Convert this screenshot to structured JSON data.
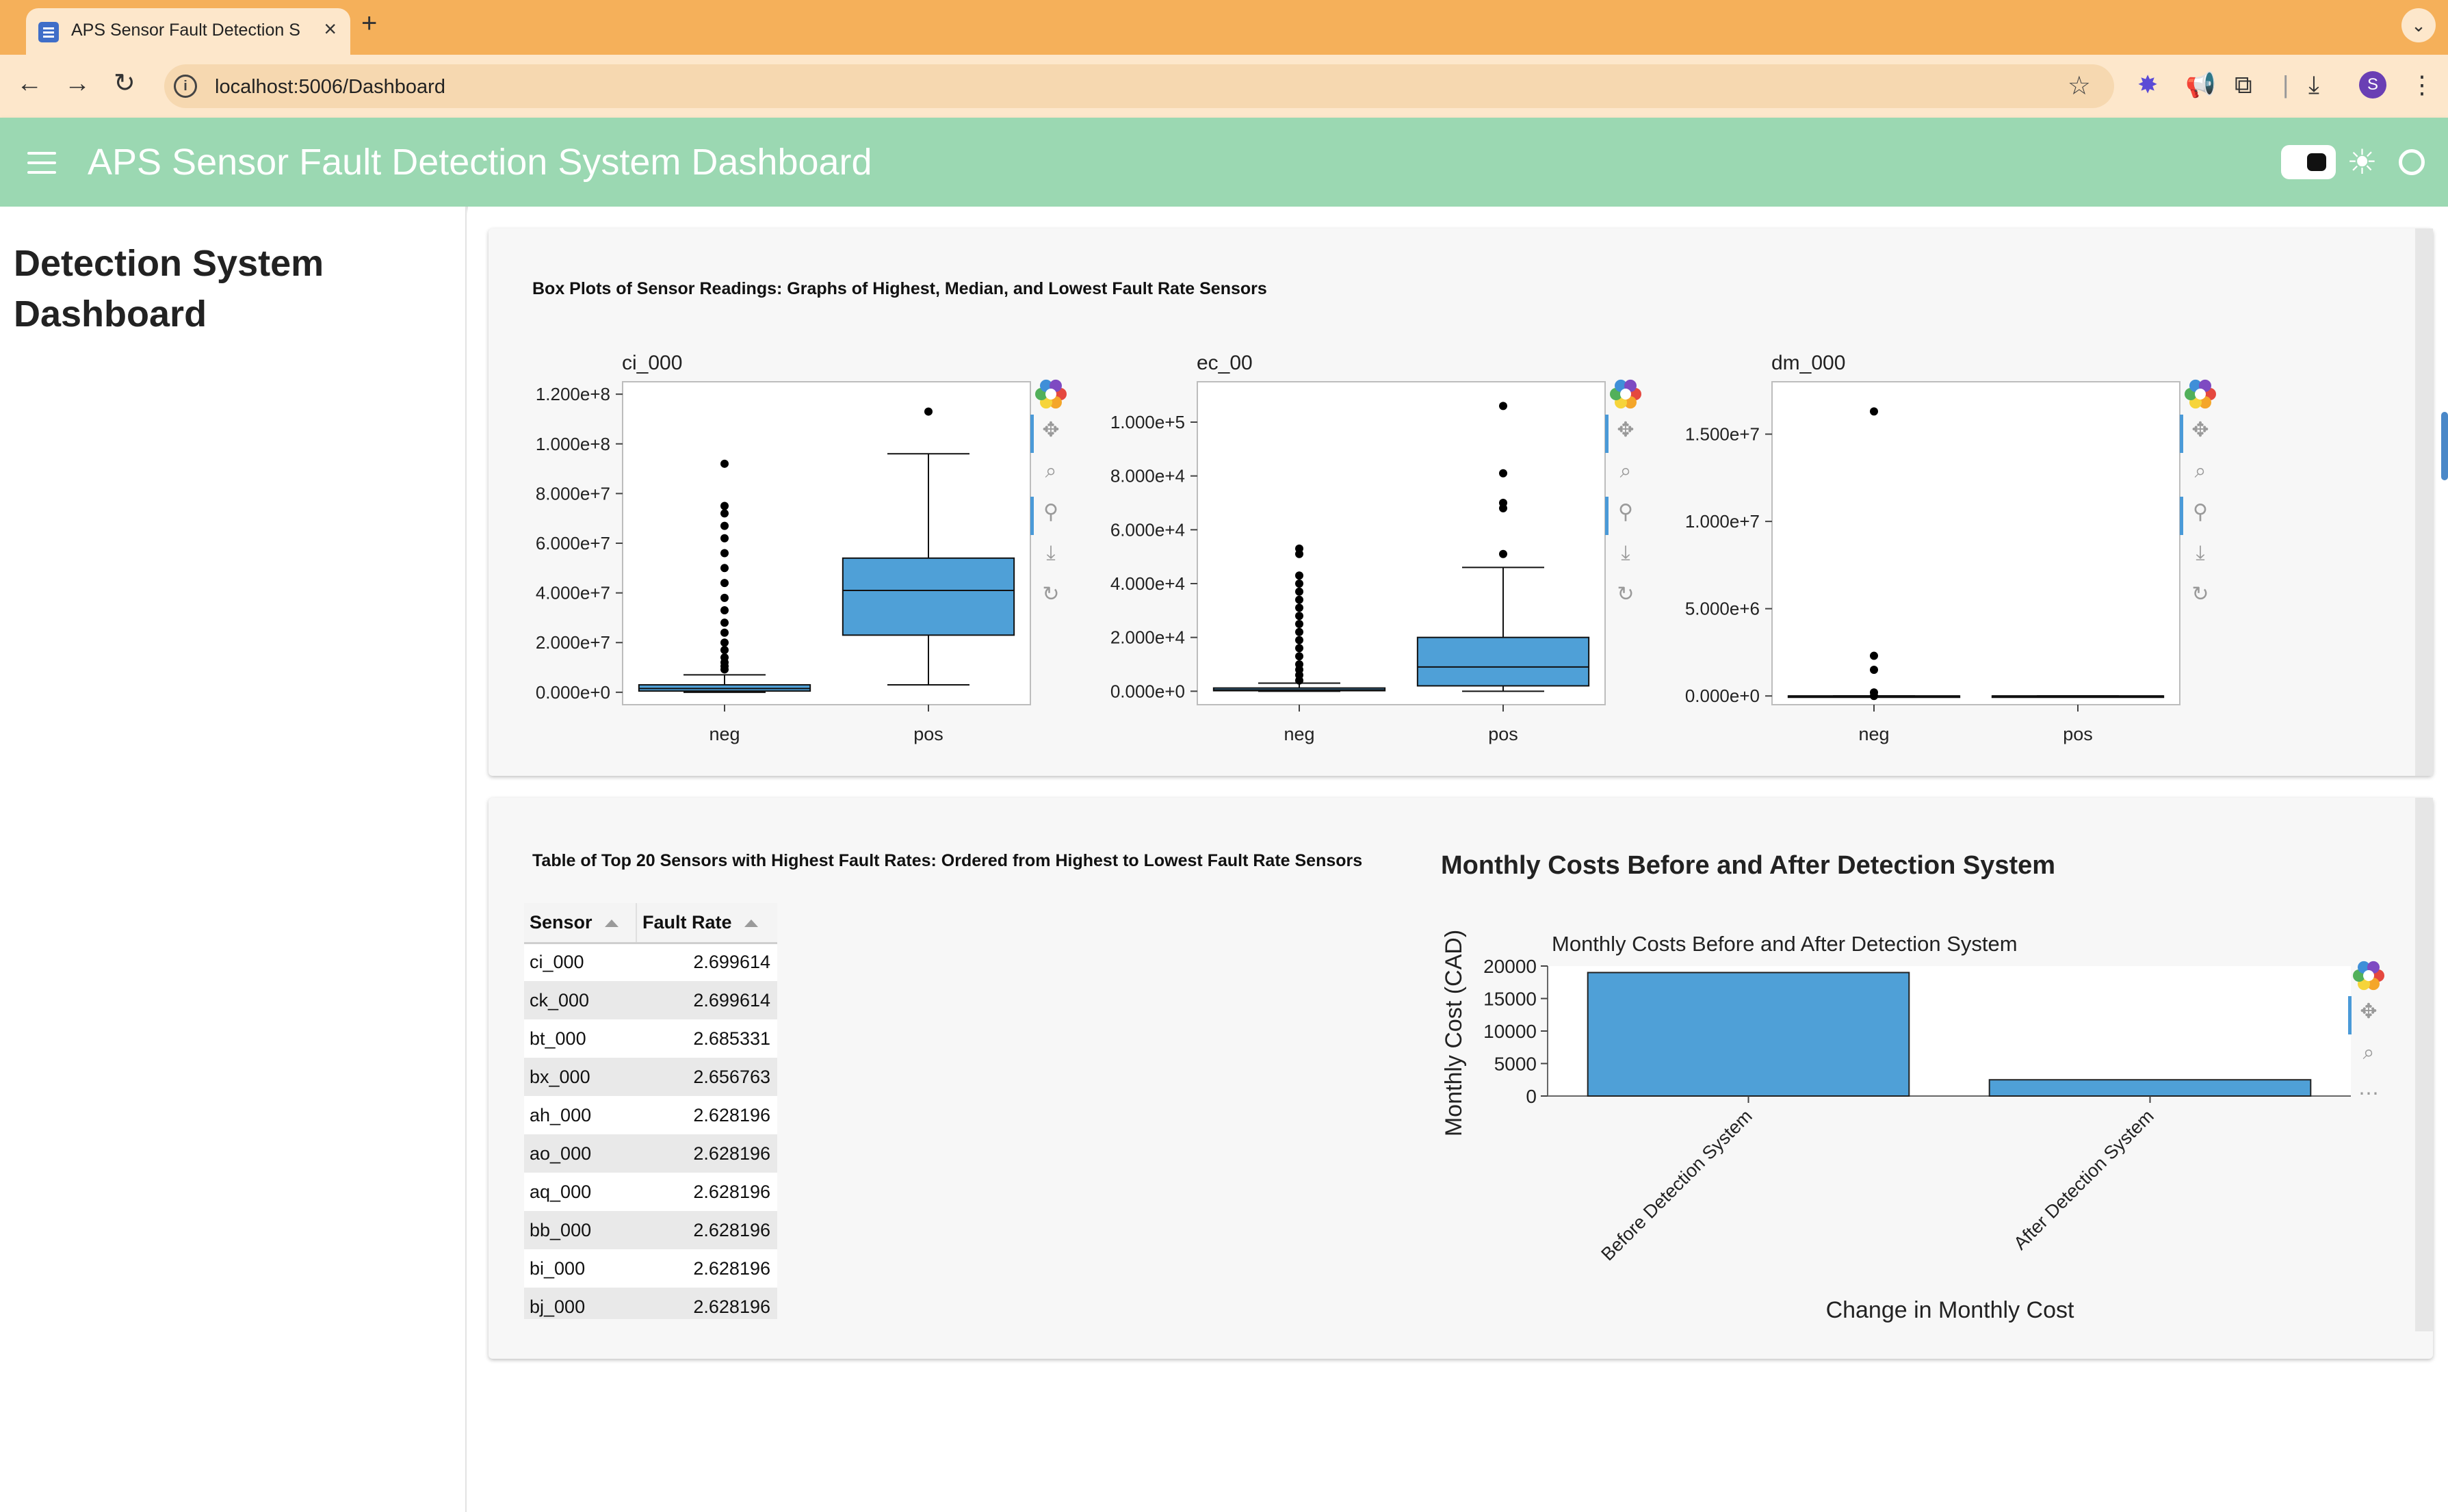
{
  "browser": {
    "tab_title": "APS Sensor Fault Detection S",
    "url": "localhost:5006/Dashboard",
    "profile_initial": "S"
  },
  "app": {
    "title": "APS Sensor Fault Detection System Dashboard"
  },
  "sidebar": {
    "title": "Detection System Dashboard"
  },
  "boxplots_section": {
    "heading": "Box Plots of Sensor Readings: Graphs of Highest, Median, and Lowest Fault Rate Sensors"
  },
  "table_section": {
    "heading": "Table of Top 20 Sensors with Highest Fault Rates: Ordered from Highest to Lowest Fault Rate Sensors",
    "columns": [
      "Sensor",
      "Fault Rate"
    ],
    "rows": [
      {
        "sensor": "ci_000",
        "rate": "2.699614"
      },
      {
        "sensor": "ck_000",
        "rate": "2.699614"
      },
      {
        "sensor": "bt_000",
        "rate": "2.685331"
      },
      {
        "sensor": "bx_000",
        "rate": "2.656763"
      },
      {
        "sensor": "ah_000",
        "rate": "2.628196"
      },
      {
        "sensor": "ao_000",
        "rate": "2.628196"
      },
      {
        "sensor": "aq_000",
        "rate": "2.628196"
      },
      {
        "sensor": "bb_000",
        "rate": "2.628196"
      },
      {
        "sensor": "bi_000",
        "rate": "2.628196"
      },
      {
        "sensor": "bj_000",
        "rate": "2.628196"
      }
    ]
  },
  "cost_section": {
    "heading": "Monthly Costs Before and After Detection System"
  },
  "colors": {
    "header_bg": "#9bd8b2",
    "tabbar_bg": "#f5b05a",
    "bar_fill": "#4fa0d7"
  },
  "chart_data": [
    {
      "type": "box",
      "title": "ci_000",
      "categories": [
        "neg",
        "pos"
      ],
      "ylim": [
        -5000000,
        125000000
      ],
      "yticks": [
        0,
        20000000,
        40000000,
        60000000,
        80000000,
        100000000,
        120000000
      ],
      "ytick_labels": [
        "0.000e+0",
        "2.000e+7",
        "4.000e+7",
        "6.000e+7",
        "8.000e+7",
        "1.000e+8",
        "1.200e+8"
      ],
      "boxes": [
        {
          "category": "neg",
          "whisker_low": 0,
          "q1": 500000,
          "median": 1500000,
          "q3": 3000000,
          "whisker_high": 7000000,
          "outliers": [
            9200000,
            10500000,
            12000000,
            14000000,
            17000000,
            20000000,
            24000000,
            28000000,
            33000000,
            38000000,
            44000000,
            50000000,
            56000000,
            62000000,
            67000000,
            72000000,
            75000000,
            92000000
          ]
        },
        {
          "category": "pos",
          "whisker_low": 3000000,
          "q1": 23000000,
          "median": 41000000,
          "q3": 54000000,
          "whisker_high": 96000000,
          "outliers": [
            113000000
          ]
        }
      ]
    },
    {
      "type": "box",
      "title": "ec_00",
      "categories": [
        "neg",
        "pos"
      ],
      "ylim": [
        -5000,
        115000
      ],
      "yticks": [
        0,
        20000,
        40000,
        60000,
        80000,
        100000
      ],
      "ytick_labels": [
        "0.000e+0",
        "2.000e+4",
        "4.000e+4",
        "6.000e+4",
        "8.000e+4",
        "1.000e+5"
      ],
      "boxes": [
        {
          "category": "neg",
          "whisker_low": 0,
          "q1": 200,
          "median": 500,
          "q3": 1200,
          "whisker_high": 3000,
          "outliers": [
            4000,
            6000,
            8000,
            10000,
            13000,
            16000,
            19000,
            22000,
            25000,
            28000,
            31000,
            34000,
            37000,
            40000,
            43000,
            51000,
            53000
          ]
        },
        {
          "category": "pos",
          "whisker_low": 0,
          "q1": 2000,
          "median": 9000,
          "q3": 20000,
          "whisker_high": 46000,
          "outliers": [
            51000,
            68000,
            70000,
            81000,
            106000
          ]
        }
      ]
    },
    {
      "type": "box",
      "title": "dm_000",
      "categories": [
        "neg",
        "pos"
      ],
      "ylim": [
        -500000,
        18000000
      ],
      "yticks": [
        0,
        5000000,
        10000000,
        15000000
      ],
      "ytick_labels": [
        "0.000e+0",
        "5.000e+6",
        "1.000e+7",
        "1.500e+7"
      ],
      "boxes": [
        {
          "category": "neg",
          "whisker_low": 0,
          "q1": 0,
          "median": 0,
          "q3": 0,
          "whisker_high": 0,
          "outliers": [
            0,
            200000,
            1500000,
            2300000,
            16300000
          ]
        },
        {
          "category": "pos",
          "whisker_low": 0,
          "q1": 0,
          "median": 0,
          "q3": 0,
          "whisker_high": 0,
          "outliers": []
        }
      ]
    },
    {
      "type": "bar",
      "title": "Monthly Costs Before and After Detection System",
      "categories": [
        "Before Detection System",
        "After Detection System"
      ],
      "values": [
        19000,
        2500
      ],
      "xlabel": "Change in Monthly Cost",
      "ylabel": "Monthly Cost (CAD)",
      "ylim": [
        0,
        20000
      ],
      "yticks": [
        0,
        5000,
        10000,
        15000,
        20000
      ],
      "ytick_labels": [
        "0",
        "5000",
        "10000",
        "15000",
        "20000"
      ]
    }
  ]
}
